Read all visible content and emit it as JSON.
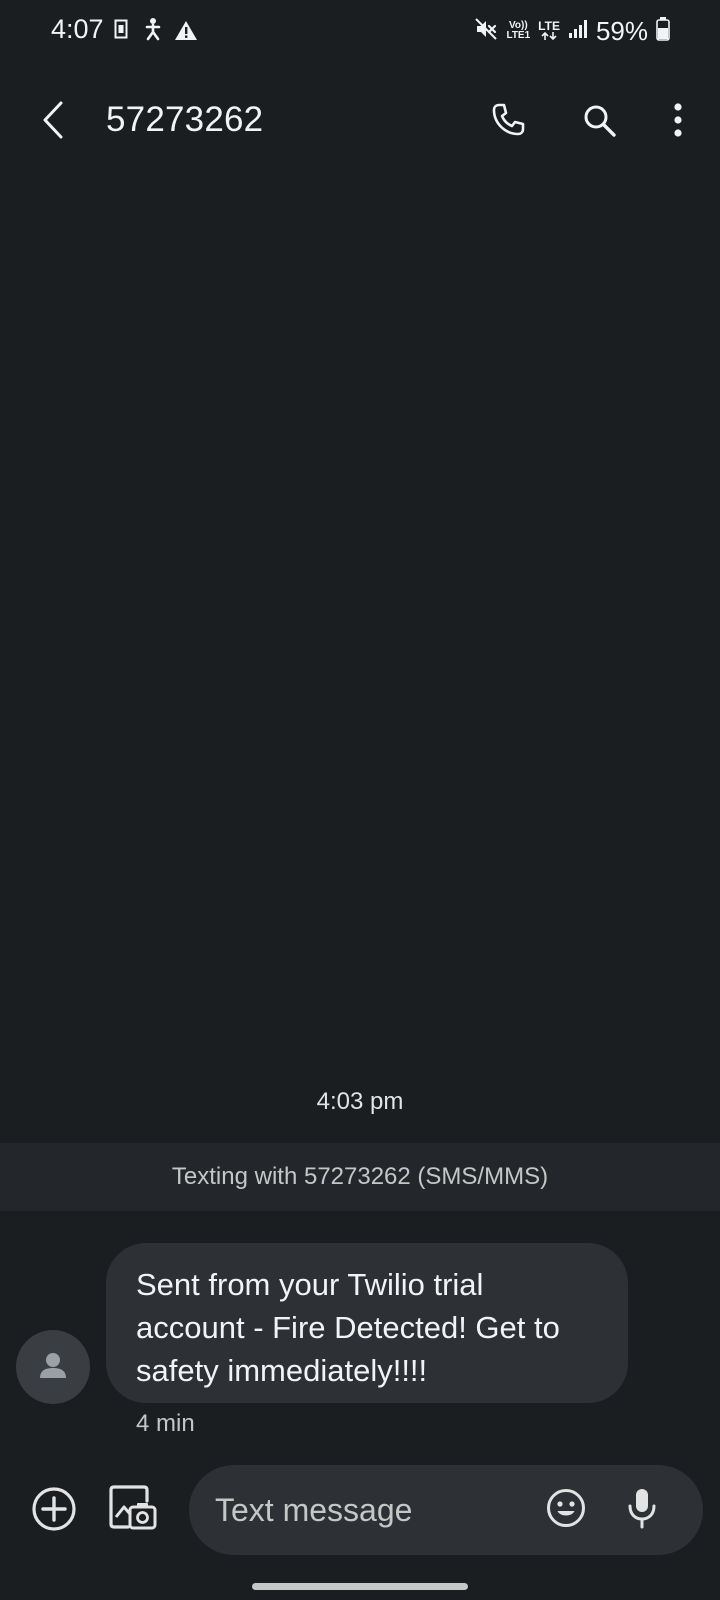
{
  "status_bar": {
    "time": "4:07",
    "battery": "59%",
    "volte_label": "Vo))",
    "volte_sub": "LTE1",
    "network_label": "LTE",
    "icons": [
      "sim-card-icon",
      "accessibility-icon",
      "warning-icon",
      "mute-icon",
      "volte-icon",
      "lte-data-icon",
      "signal-icon",
      "battery-icon"
    ]
  },
  "app_bar": {
    "title": "57273262",
    "icons": [
      "back-arrow-icon",
      "phone-icon",
      "search-icon",
      "more-vert-icon"
    ]
  },
  "conversation": {
    "timestamp": "4:03 pm",
    "banner": "Texting with 57273262 (SMS/MMS)",
    "messages": [
      {
        "direction": "incoming",
        "text": "Sent from your Twilio trial account - Fire Detected! Get to safety immediately!!!!",
        "time": "4 min"
      }
    ]
  },
  "composer": {
    "placeholder": "Text message",
    "value": "",
    "icons": [
      "add-circle-icon",
      "gallery-camera-icon",
      "emoji-icon",
      "mic-icon"
    ]
  },
  "colors": {
    "background": "#1b1e21",
    "bubble": "#2d3135",
    "banner": "#23272b",
    "text": "#f1f3f4",
    "secondary_text": "#c4c7c5"
  }
}
